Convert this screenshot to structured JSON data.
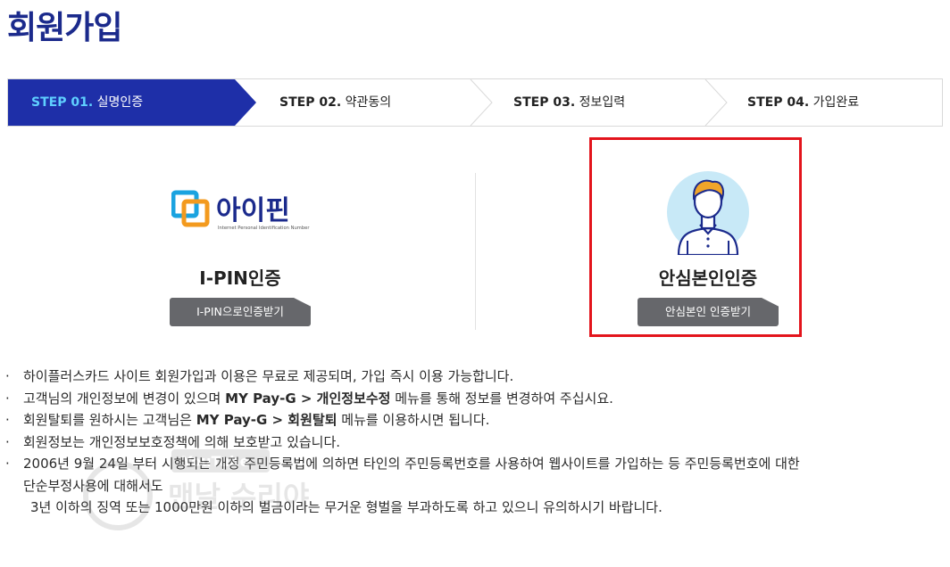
{
  "page": {
    "title": "회원가입"
  },
  "steps": [
    {
      "num": "STEP 01.",
      "label": "실명인증",
      "active": true
    },
    {
      "num": "STEP 02.",
      "label": "약관동의",
      "active": false
    },
    {
      "num": "STEP 03.",
      "label": "정보입력",
      "active": false
    },
    {
      "num": "STEP 04.",
      "label": "가입완료",
      "active": false
    }
  ],
  "colors": {
    "title": "#1b2a8c",
    "active_step": "#1e2fa8",
    "active_num": "#5fd0ff",
    "button": "#66676b",
    "highlight": "#e3141c"
  },
  "ipin": {
    "logo_text": "아이핀",
    "logo_subtext": "Internet Personal Identification Number",
    "title": "I-PIN인증",
    "button": "I-PIN으로인증받기"
  },
  "phone": {
    "icon": "person-avatar-icon",
    "title": "안심본인인증",
    "button": "안심본인 인증받기"
  },
  "notes": {
    "n1": "하이플러스카드 사이트 회원가입과 이용은 무료로 제공되며, 가입 즉시 이용 가능합니다.",
    "n2_a": "고객님의 개인정보에 변경이 있으며 ",
    "n2_b": "MY Pay-G > 개인정보수정",
    "n2_c": " 메뉴를 통해 정보를 변경하여 주십시요.",
    "n3_a": "회원탈퇴를 원하시는 고객님은 ",
    "n3_b": "MY Pay-G > 회원탈퇴",
    "n3_c": " 메뉴를 이용하시면 됩니다.",
    "n4": "회원정보는 개인정보보호정책에 의해 보호받고 있습니다.",
    "n5_l1": "2006년 9월 24일 부터 시행되는 개정 주민등록법에 의하면 타인의 주민등록번호를 사용하여 웹사이트를 가입하는 등 주민등록번호에 대한",
    "n5_l2": "단순부정사용에 대해서도",
    "n5_l3": "3년 이하의 징역 또는 1000만원 이하의 벌금이라는 무거운 형벌을 부과하도록 하고 있으니 유의하시기 바랍니다.",
    "bullet": "·"
  },
  "watermark": {
    "line1": "YouTube",
    "line2": "맨날 수리야"
  }
}
